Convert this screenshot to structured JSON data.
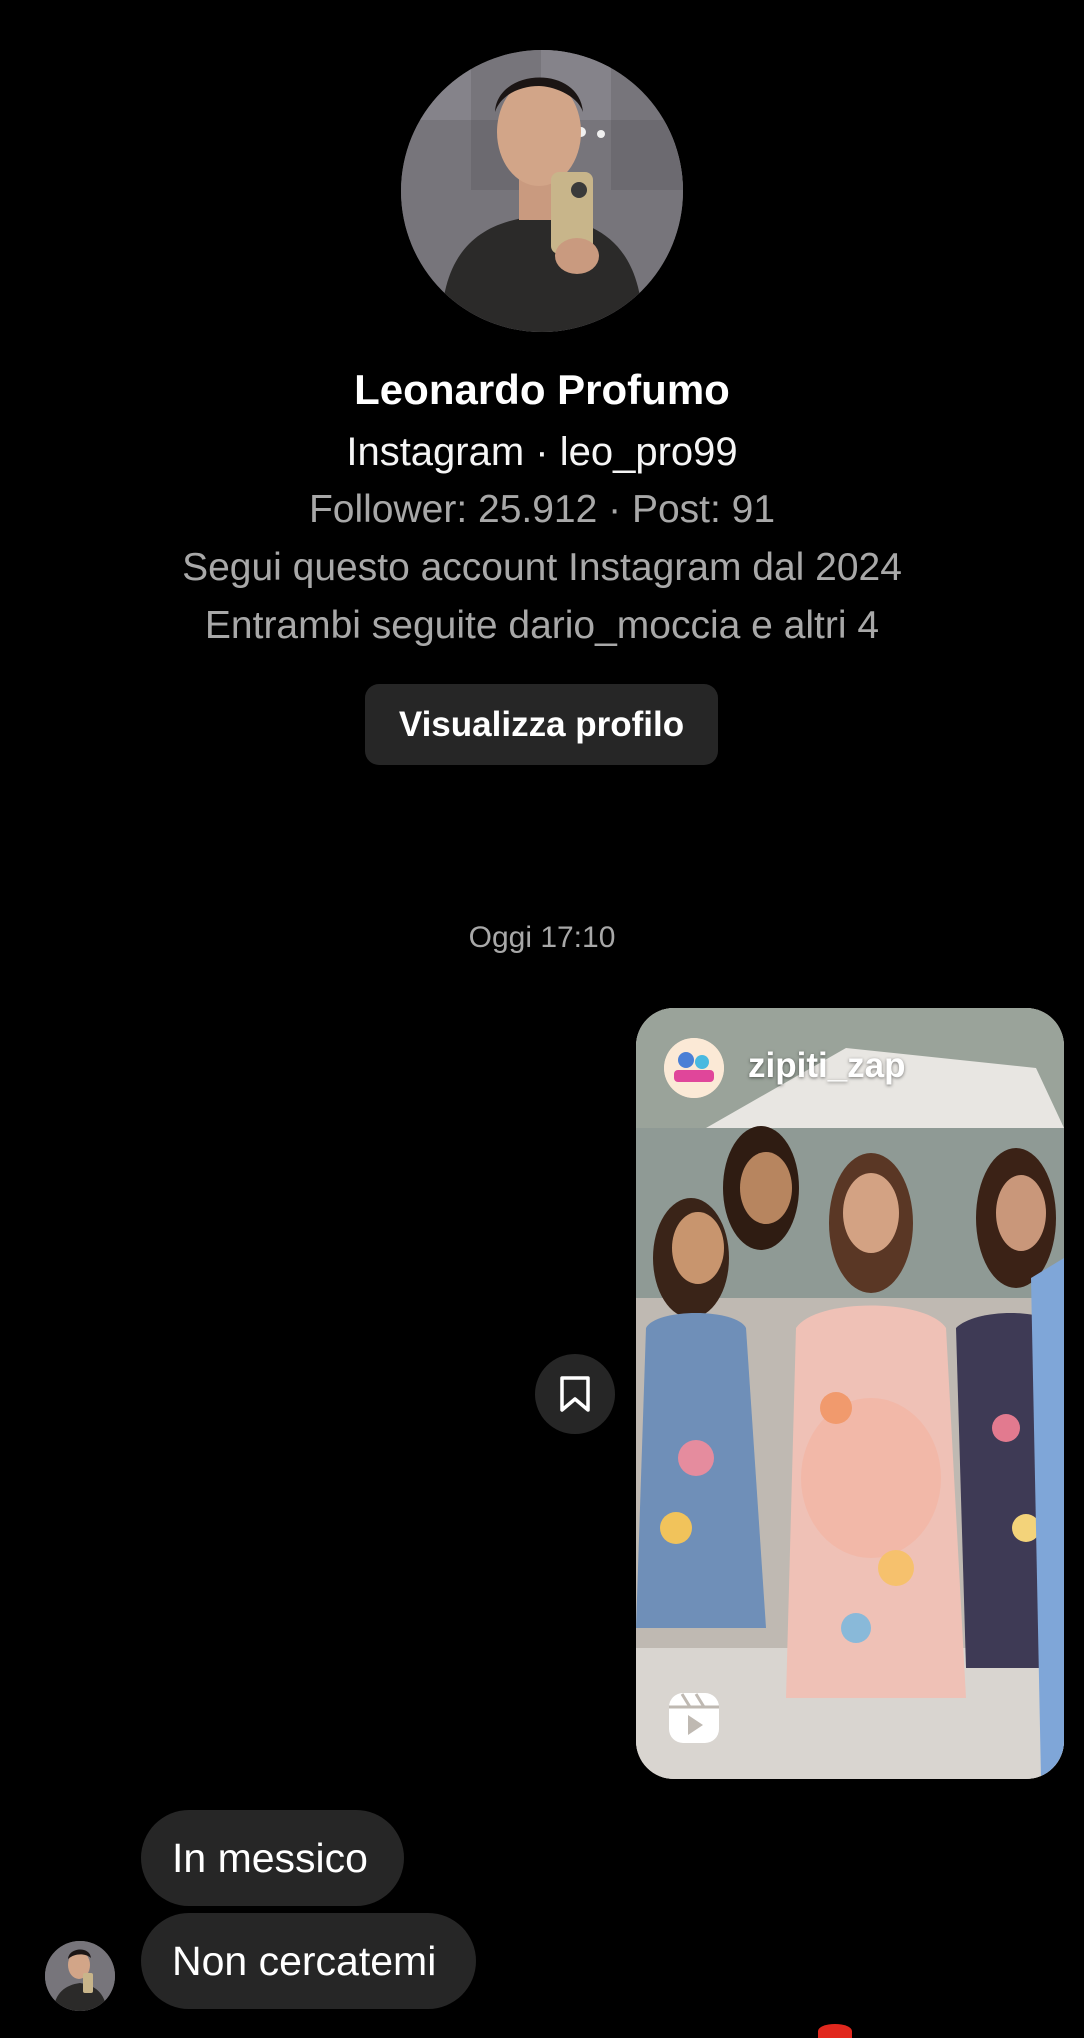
{
  "profile": {
    "name": "Leonardo Profumo",
    "platform_line": "Instagram · leo_pro99",
    "stats_line": "Follower: 25.912 · Post: 91",
    "follow_since_line": "Segui questo account Instagram dal 2024",
    "mutual_line": "Entrambi seguite dario_moccia e altri 4",
    "view_profile_label": "Visualizza profilo"
  },
  "chat": {
    "timestamp": "Oggi 17:10",
    "shared_reel": {
      "owner": "zipiti_zap",
      "owner_avatar_icon": "zipiti-zap-logo",
      "type_icon": "reels-icon"
    },
    "save_icon": "bookmark-icon",
    "messages": [
      {
        "text": "In messico"
      },
      {
        "text": "Non cercatemi"
      }
    ],
    "reaction_icon": "heart-icon"
  },
  "colors": {
    "background": "#000000",
    "bubble": "#262626",
    "secondary_text": "#a8a8a8",
    "reaction": "#e1281e"
  }
}
